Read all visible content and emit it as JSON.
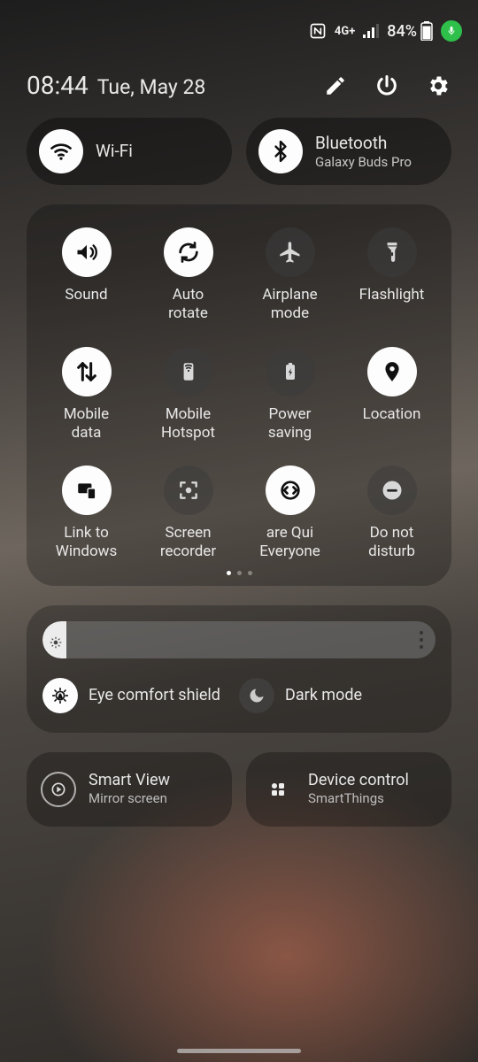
{
  "status": {
    "nfc_label": "N",
    "network_label": "4G+",
    "battery_text": "84%"
  },
  "header": {
    "time": "08:44",
    "date": "Tue, May 28"
  },
  "pills": {
    "wifi": {
      "label": "Wi-Fi"
    },
    "bluetooth": {
      "label": "Bluetooth",
      "device": "Galaxy Buds Pro"
    }
  },
  "tiles": [
    {
      "name": "sound",
      "label": "Sound",
      "active": true
    },
    {
      "name": "auto-rotate",
      "label": "Auto\nrotate",
      "active": true
    },
    {
      "name": "airplane-mode",
      "label": "Airplane\nmode",
      "active": false
    },
    {
      "name": "flashlight",
      "label": "Flashlight",
      "active": false
    },
    {
      "name": "mobile-data",
      "label": "Mobile\ndata",
      "active": true
    },
    {
      "name": "mobile-hotspot",
      "label": "Mobile\nHotspot",
      "active": false
    },
    {
      "name": "power-saving",
      "label": "Power\nsaving",
      "active": false
    },
    {
      "name": "location",
      "label": "Location",
      "active": true
    },
    {
      "name": "link-windows",
      "label": "Link to\nWindows",
      "active": true
    },
    {
      "name": "screen-recorder",
      "label": "Screen\nrecorder",
      "active": false
    },
    {
      "name": "quick-share",
      "label": "are     Qui\nEveryone",
      "active": true
    },
    {
      "name": "do-not-disturb",
      "label": "Do not\ndisturb",
      "active": false
    }
  ],
  "brightness": {
    "percent": 6,
    "eye_comfort_label": "Eye comfort shield",
    "eye_comfort_active": true,
    "dark_mode_label": "Dark mode",
    "dark_mode_active": false
  },
  "bottom": {
    "smartview": {
      "label": "Smart View",
      "sub": "Mirror screen"
    },
    "devicecontrol": {
      "label": "Device control",
      "sub": "SmartThings"
    }
  }
}
